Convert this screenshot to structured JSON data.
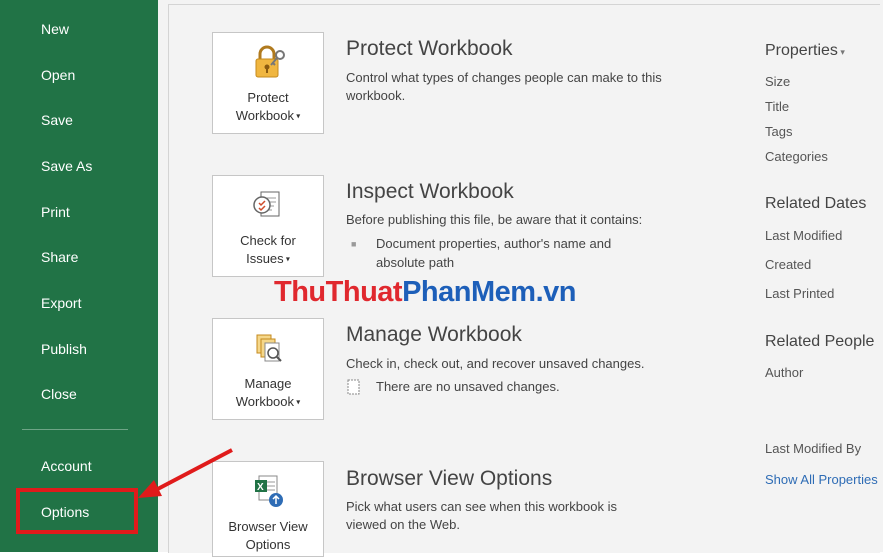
{
  "sidebar": {
    "items": [
      {
        "label": "New"
      },
      {
        "label": "Open"
      },
      {
        "label": "Save"
      },
      {
        "label": "Save As"
      },
      {
        "label": "Print"
      },
      {
        "label": "Share"
      },
      {
        "label": "Export"
      },
      {
        "label": "Publish"
      },
      {
        "label": "Close"
      }
    ],
    "account": "Account",
    "options": "Options"
  },
  "sections": {
    "protect": {
      "tile_line1": "Protect",
      "tile_line2": "Workbook",
      "title": "Protect Workbook",
      "desc": "Control what types of changes people can make to this workbook."
    },
    "inspect": {
      "tile_line1": "Check for",
      "tile_line2": "Issues",
      "title": "Inspect Workbook",
      "desc": "Before publishing this file, be aware that it contains:",
      "bullet_line1": "Document properties, author's name and",
      "bullet_line2": "absolute path"
    },
    "manage": {
      "tile_line1": "Manage",
      "tile_line2": "Workbook",
      "title": "Manage Workbook",
      "desc": "Check in, check out, and recover unsaved changes.",
      "note": "There are no unsaved changes."
    },
    "browser": {
      "tile_line1": "Browser View",
      "tile_line2": "Options",
      "title": "Browser View Options",
      "desc": "Pick what users can see when this workbook is viewed on the Web."
    }
  },
  "properties": {
    "heading": "Properties",
    "items": [
      "Size",
      "Title",
      "Tags",
      "Categories"
    ],
    "related_dates": "Related Dates",
    "dates": [
      "Last Modified",
      "Created",
      "Last Printed"
    ],
    "related_people": "Related People",
    "people": [
      "Author"
    ],
    "last_modified_by": "Last Modified By",
    "show_all": "Show All Properties"
  },
  "watermark": {
    "part1": "ThuThuat",
    "part2": "PhanMem",
    "part3": ".vn"
  },
  "colors": {
    "sidebar": "#217346",
    "accent_link": "#2e6cb5",
    "annotation_red": "#e01b1b",
    "wm_red": "#e0282e",
    "wm_blue": "#1d5fb9"
  }
}
